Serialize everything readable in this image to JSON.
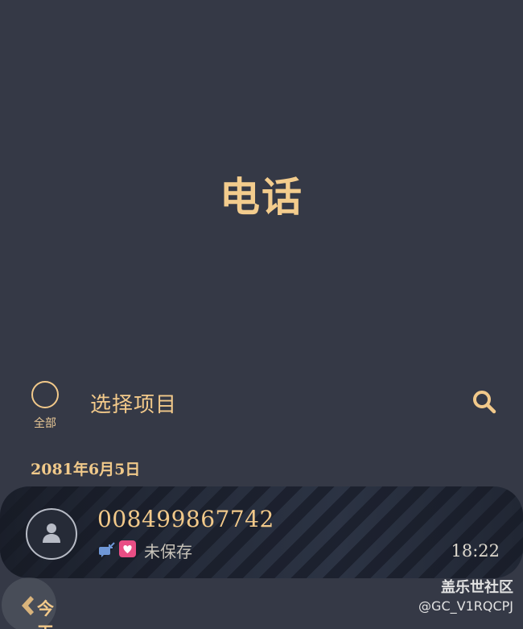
{
  "header": {
    "title": "电话"
  },
  "toolbar": {
    "select_all_label": "全部",
    "select_items_label": "选择项目",
    "search_icon": "search-icon"
  },
  "call_log": {
    "date_header": "2081年6月5日",
    "items": [
      {
        "number": "008499867742",
        "status": "未保存",
        "time": "18:22",
        "call_type_icon": "missed-call-icon",
        "tag_icon": "heart-icon"
      }
    ]
  },
  "footer": {
    "today_label": "今天"
  },
  "watermark": {
    "title": "盖乐世社区",
    "user": "@GC_V1RQCPJ"
  },
  "colors": {
    "background": "#353946",
    "accent": "#f2c98a",
    "favorite": "#e94e85"
  }
}
